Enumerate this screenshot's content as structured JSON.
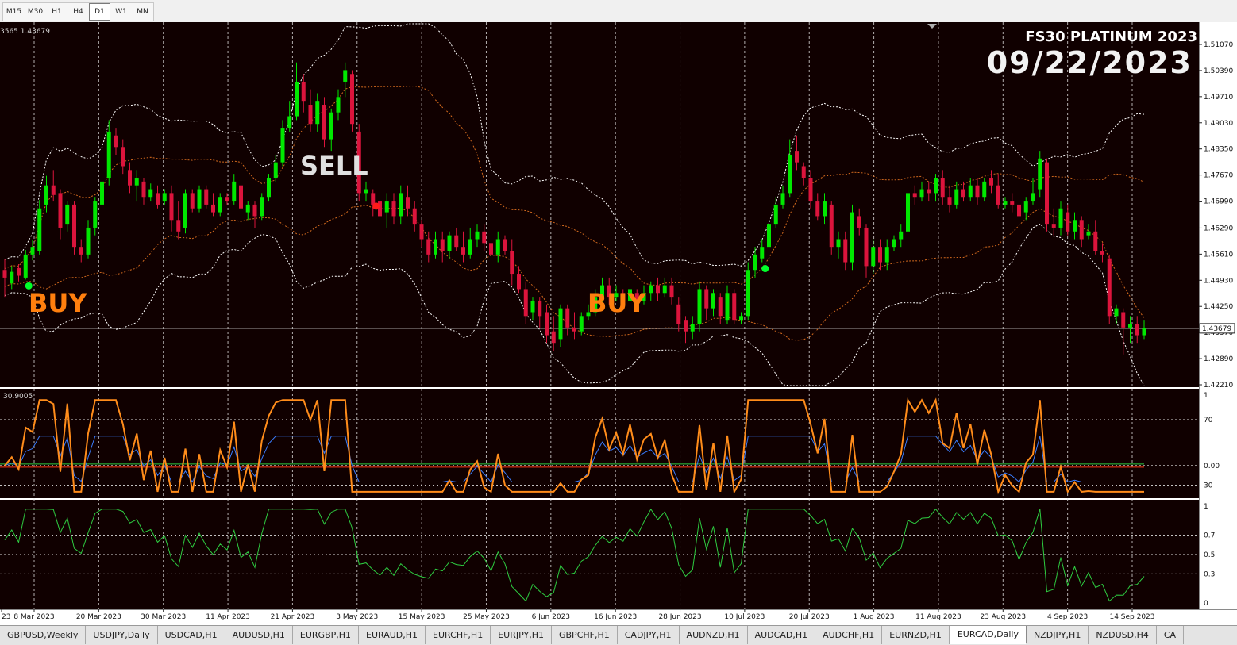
{
  "timeframes": [
    {
      "label": "M15",
      "active": false
    },
    {
      "label": "M30",
      "active": false
    },
    {
      "label": "H1",
      "active": false
    },
    {
      "label": "H4",
      "active": false
    },
    {
      "label": "D1",
      "active": true
    },
    {
      "label": "W1",
      "active": false
    },
    {
      "label": "MN",
      "active": false
    }
  ],
  "price_header": "3565 1.43679",
  "brand": {
    "title": "FS30 PLATINUM 2023",
    "date": "09/22/2023"
  },
  "annotations": {
    "buy1": "BUY",
    "sell1": "SELL",
    "buy2": "BUY"
  },
  "price_axis": {
    "ticks": [
      "1.51070",
      "1.50390",
      "1.49710",
      "1.49030",
      "1.48350",
      "1.47670",
      "1.46990",
      "1.46290",
      "1.45610",
      "1.44930",
      "1.44250",
      "1.43570",
      "1.42890",
      "1.42210"
    ],
    "current": "1.43679"
  },
  "indicator1": {
    "header": "30.9005",
    "ticks": [
      "1",
      "70",
      "0.00",
      "30"
    ]
  },
  "indicator2": {
    "ticks": [
      "1",
      "0.7",
      "0.5",
      "0.3",
      "0"
    ]
  },
  "time_axis": [
    "23",
    "8 Mar 2023",
    "20 Mar 2023",
    "30 Mar 2023",
    "11 Apr 2023",
    "21 Apr 2023",
    "3 May 2023",
    "15 May 2023",
    "25 May 2023",
    "6 Jun 2023",
    "16 Jun 2023",
    "28 Jun 2023",
    "10 Jul 2023",
    "20 Jul 2023",
    "1 Aug 2023",
    "11 Aug 2023",
    "23 Aug 2023",
    "4 Sep 2023",
    "14 Sep 2023"
  ],
  "colors": {
    "bg": "#100000",
    "bull": "#00e800",
    "bear": "#dc143c",
    "band_outer": "#ffffff",
    "band_mid": "#d2691e",
    "ind_blue": "#3a7dff",
    "ind_orange": "#ff8c1a",
    "ind_green": "#2ecc40",
    "buy_text": "#ff7f0e",
    "sell_text": "#e0e0e0"
  },
  "chart_data": {
    "type": "candlestick",
    "symbol": "EURCAD",
    "timeframe": "Daily",
    "ylim": [
      1.4221,
      1.5107
    ],
    "last_price": 1.43679,
    "candles": [
      [
        1.452,
        1.45,
        1.445,
        1.4548
      ],
      [
        1.4485,
        1.4515,
        1.447,
        1.453
      ],
      [
        1.4525,
        1.4505,
        1.449,
        1.4535
      ],
      [
        1.45,
        1.456,
        1.4495,
        1.4572
      ],
      [
        1.456,
        1.458,
        1.4545,
        1.4598
      ],
      [
        1.457,
        1.468,
        1.456,
        1.4702
      ],
      [
        1.469,
        1.474,
        1.467,
        1.4765
      ],
      [
        1.474,
        1.4715,
        1.47,
        1.478
      ],
      [
        1.472,
        1.463,
        1.46,
        1.473
      ],
      [
        1.464,
        1.469,
        1.462,
        1.47
      ],
      [
        1.469,
        1.458,
        1.456,
        1.47
      ],
      [
        1.458,
        1.456,
        1.454,
        1.46
      ],
      [
        1.456,
        1.463,
        1.455,
        1.465
      ],
      [
        1.463,
        1.47,
        1.461,
        1.471
      ],
      [
        1.469,
        1.475,
        1.468,
        1.477
      ],
      [
        1.476,
        1.488,
        1.474,
        1.491
      ],
      [
        1.487,
        1.484,
        1.482,
        1.489
      ],
      [
        1.484,
        1.479,
        1.477,
        1.486
      ],
      [
        1.478,
        1.474,
        1.472,
        1.48
      ],
      [
        1.474,
        1.476,
        1.47,
        1.478
      ],
      [
        1.475,
        1.471,
        1.469,
        1.476
      ],
      [
        1.471,
        1.473,
        1.47,
        1.4745
      ],
      [
        1.472,
        1.469,
        1.468,
        1.474
      ],
      [
        1.47,
        1.472,
        1.469,
        1.473
      ],
      [
        1.472,
        1.465,
        1.462,
        1.474
      ],
      [
        1.465,
        1.462,
        1.46,
        1.47
      ],
      [
        1.463,
        1.472,
        1.4615,
        1.473
      ],
      [
        1.472,
        1.468,
        1.467,
        1.473
      ],
      [
        1.468,
        1.473,
        1.467,
        1.474
      ],
      [
        1.473,
        1.469,
        1.468,
        1.474
      ],
      [
        1.469,
        1.467,
        1.466,
        1.472
      ],
      [
        1.467,
        1.471,
        1.466,
        1.472
      ],
      [
        1.471,
        1.47,
        1.469,
        1.472
      ],
      [
        1.47,
        1.475,
        1.469,
        1.477
      ],
      [
        1.474,
        1.468,
        1.466,
        1.475
      ],
      [
        1.467,
        1.469,
        1.465,
        1.47
      ],
      [
        1.469,
        1.466,
        1.463,
        1.47
      ],
      [
        1.466,
        1.471,
        1.465,
        1.472
      ],
      [
        1.471,
        1.476,
        1.47,
        1.477
      ],
      [
        1.476,
        1.48,
        1.475,
        1.482
      ],
      [
        1.48,
        1.489,
        1.479,
        1.491
      ],
      [
        1.489,
        1.492,
        1.488,
        1.496
      ],
      [
        1.492,
        1.501,
        1.491,
        1.506
      ],
      [
        1.501,
        1.496,
        1.493,
        1.503
      ],
      [
        1.495,
        1.49,
        1.488,
        1.499
      ],
      [
        1.49,
        1.496,
        1.488,
        1.498
      ],
      [
        1.495,
        1.486,
        1.484,
        1.497
      ],
      [
        1.486,
        1.493,
        1.483,
        1.494
      ],
      [
        1.493,
        1.497,
        1.491,
        1.499
      ],
      [
        1.501,
        1.504,
        1.497,
        1.506
      ],
      [
        1.503,
        1.49,
        1.488,
        1.504
      ],
      [
        1.488,
        1.472,
        1.47,
        1.49
      ],
      [
        1.472,
        1.473,
        1.47,
        1.475
      ],
      [
        1.472,
        1.469,
        1.466,
        1.473
      ],
      [
        1.47,
        1.466,
        1.463,
        1.472
      ],
      [
        1.467,
        1.47,
        1.463,
        1.472
      ],
      [
        1.47,
        1.466,
        1.464,
        1.472
      ],
      [
        1.466,
        1.472,
        1.464,
        1.474
      ],
      [
        1.471,
        1.468,
        1.466,
        1.474
      ],
      [
        1.468,
        1.464,
        1.462,
        1.47
      ],
      [
        1.464,
        1.46,
        1.458,
        1.465
      ],
      [
        1.46,
        1.456,
        1.454,
        1.462
      ],
      [
        1.456,
        1.46,
        1.455,
        1.462
      ],
      [
        1.46,
        1.457,
        1.454,
        1.462
      ],
      [
        1.457,
        1.461,
        1.455,
        1.462
      ],
      [
        1.461,
        1.458,
        1.457,
        1.463
      ],
      [
        1.458,
        1.456,
        1.454,
        1.462
      ],
      [
        1.456,
        1.46,
        1.455,
        1.463
      ],
      [
        1.46,
        1.462,
        1.458,
        1.464
      ],
      [
        1.462,
        1.459,
        1.457,
        1.464
      ],
      [
        1.459,
        1.456,
        1.455,
        1.461
      ],
      [
        1.456,
        1.46,
        1.454,
        1.462
      ],
      [
        1.46,
        1.457,
        1.456,
        1.461
      ],
      [
        1.457,
        1.451,
        1.448,
        1.46
      ],
      [
        1.451,
        1.447,
        1.446,
        1.453
      ],
      [
        1.447,
        1.44,
        1.438,
        1.449
      ],
      [
        1.441,
        1.444,
        1.439,
        1.445
      ],
      [
        1.444,
        1.44,
        1.437,
        1.445
      ],
      [
        1.441,
        1.435,
        1.433,
        1.443
      ],
      [
        1.436,
        1.433,
        1.431,
        1.44
      ],
      [
        1.434,
        1.442,
        1.432,
        1.443
      ],
      [
        1.442,
        1.437,
        1.435,
        1.443
      ],
      [
        1.437,
        1.436,
        1.434,
        1.441
      ],
      [
        1.436,
        1.44,
        1.435,
        1.441
      ],
      [
        1.44,
        1.441,
        1.439,
        1.443
      ],
      [
        1.441,
        1.445,
        1.44,
        1.447
      ],
      [
        1.445,
        1.448,
        1.443,
        1.45
      ],
      [
        1.448,
        1.445,
        1.443,
        1.45
      ],
      [
        1.445,
        1.446,
        1.444,
        1.448
      ],
      [
        1.446,
        1.444,
        1.443,
        1.447
      ],
      [
        1.444,
        1.447,
        1.443,
        1.449
      ],
      [
        1.446,
        1.444,
        1.443,
        1.447
      ],
      [
        1.444,
        1.446,
        1.443,
        1.448
      ],
      [
        1.446,
        1.448,
        1.444,
        1.449
      ],
      [
        1.448,
        1.446,
        1.444,
        1.45
      ],
      [
        1.446,
        1.448,
        1.445,
        1.45
      ],
      [
        1.448,
        1.445,
        1.443,
        1.45
      ],
      [
        1.443,
        1.438,
        1.436,
        1.445
      ],
      [
        1.439,
        1.436,
        1.433,
        1.44
      ],
      [
        1.436,
        1.438,
        1.434,
        1.44
      ],
      [
        1.438,
        1.447,
        1.436,
        1.449
      ],
      [
        1.447,
        1.442,
        1.439,
        1.448
      ],
      [
        1.442,
        1.446,
        1.44,
        1.447
      ],
      [
        1.445,
        1.44,
        1.438,
        1.446
      ],
      [
        1.439,
        1.446,
        1.438,
        1.448
      ],
      [
        1.446,
        1.439,
        1.438,
        1.447
      ],
      [
        1.439,
        1.44,
        1.438,
        1.441
      ],
      [
        1.44,
        1.452,
        1.439,
        1.454
      ],
      [
        1.452,
        1.456,
        1.45,
        1.458
      ],
      [
        1.455,
        1.458,
        1.454,
        1.46
      ],
      [
        1.458,
        1.464,
        1.457,
        1.465
      ],
      [
        1.464,
        1.469,
        1.463,
        1.471
      ],
      [
        1.469,
        1.472,
        1.468,
        1.474
      ],
      [
        1.472,
        1.482,
        1.471,
        1.486
      ],
      [
        1.483,
        1.48,
        1.478,
        1.487
      ],
      [
        1.479,
        1.476,
        1.474,
        1.48
      ],
      [
        1.476,
        1.47,
        1.468,
        1.478
      ],
      [
        1.47,
        1.466,
        1.465,
        1.472
      ],
      [
        1.466,
        1.47,
        1.464,
        1.472
      ],
      [
        1.469,
        1.458,
        1.456,
        1.47
      ],
      [
        1.458,
        1.46,
        1.455,
        1.462
      ],
      [
        1.46,
        1.454,
        1.452,
        1.462
      ],
      [
        1.454,
        1.467,
        1.452,
        1.469
      ],
      [
        1.466,
        1.463,
        1.461,
        1.468
      ],
      [
        1.463,
        1.453,
        1.45,
        1.464
      ],
      [
        1.453,
        1.458,
        1.451,
        1.46
      ],
      [
        1.458,
        1.454,
        1.452,
        1.46
      ],
      [
        1.454,
        1.458,
        1.452,
        1.46
      ],
      [
        1.458,
        1.46,
        1.457,
        1.461
      ],
      [
        1.46,
        1.462,
        1.458,
        1.464
      ],
      [
        1.462,
        1.472,
        1.46,
        1.473
      ],
      [
        1.472,
        1.471,
        1.469,
        1.474
      ],
      [
        1.471,
        1.473,
        1.47,
        1.475
      ],
      [
        1.473,
        1.472,
        1.47,
        1.475
      ],
      [
        1.472,
        1.476,
        1.47,
        1.477
      ],
      [
        1.476,
        1.471,
        1.469,
        1.478
      ],
      [
        1.471,
        1.469,
        1.467,
        1.474
      ],
      [
        1.469,
        1.473,
        1.468,
        1.475
      ],
      [
        1.473,
        1.471,
        1.47,
        1.475
      ],
      [
        1.471,
        1.474,
        1.47,
        1.476
      ],
      [
        1.474,
        1.471,
        1.469,
        1.476
      ],
      [
        1.471,
        1.475,
        1.47,
        1.476
      ],
      [
        1.476,
        1.474,
        1.472,
        1.478
      ],
      [
        1.474,
        1.469,
        1.468,
        1.477
      ],
      [
        1.469,
        1.47,
        1.468,
        1.471
      ],
      [
        1.47,
        1.469,
        1.467,
        1.472
      ],
      [
        1.469,
        1.466,
        1.465,
        1.47
      ],
      [
        1.467,
        1.47,
        1.465,
        1.471
      ],
      [
        1.47,
        1.472,
        1.469,
        1.476
      ],
      [
        1.473,
        1.481,
        1.471,
        1.483
      ],
      [
        1.48,
        1.464,
        1.462,
        1.481
      ],
      [
        1.464,
        1.463,
        1.461,
        1.468
      ],
      [
        1.463,
        1.468,
        1.461,
        1.47
      ],
      [
        1.467,
        1.462,
        1.461,
        1.469
      ],
      [
        1.462,
        1.465,
        1.46,
        1.467
      ],
      [
        1.465,
        1.46,
        1.458,
        1.466
      ],
      [
        1.461,
        1.462,
        1.46,
        1.464
      ],
      [
        1.462,
        1.457,
        1.456,
        1.465
      ],
      [
        1.457,
        1.456,
        1.454,
        1.459
      ],
      [
        1.455,
        1.44,
        1.438,
        1.456
      ],
      [
        1.44,
        1.442,
        1.438,
        1.443
      ],
      [
        1.441,
        1.437,
        1.43,
        1.442
      ],
      [
        1.437,
        1.438,
        1.433,
        1.44
      ],
      [
        1.438,
        1.435,
        1.433,
        1.44
      ],
      [
        1.435,
        1.4368,
        1.434,
        1.439
      ]
    ],
    "markers": [
      {
        "type": "buy",
        "index": 3
      },
      {
        "type": "sell",
        "index": 53
      },
      {
        "type": "buy",
        "index": 109
      }
    ],
    "indicator1": {
      "ylim": [
        -45,
        110
      ],
      "levels": [
        70,
        0,
        -30
      ]
    },
    "indicator2": {
      "ylim": [
        0,
        1
      ],
      "levels": [
        0.7,
        0.5,
        0.3
      ]
    }
  }
}
